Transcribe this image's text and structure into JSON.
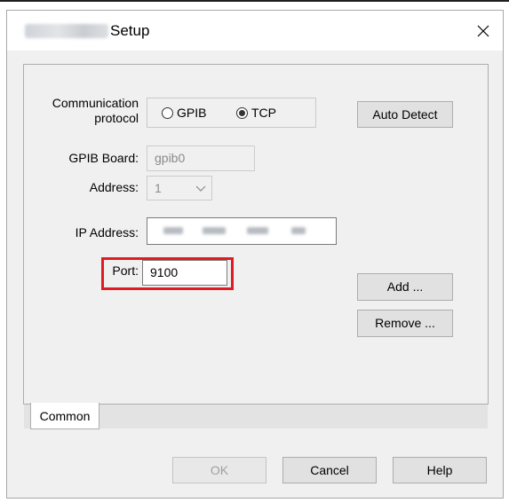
{
  "dialog": {
    "title": "Setup",
    "close_glyph": "✕",
    "icons": {
      "close": "close-icon",
      "dropdown": "chevron-down-icon"
    }
  },
  "protocol": {
    "label_line1": "Communication",
    "label_line2": "protocol",
    "options": [
      {
        "label": "GPIB",
        "checked": false
      },
      {
        "label": "TCP",
        "checked": true
      }
    ],
    "auto_detect_label": "Auto Detect"
  },
  "gpib": {
    "board_label": "GPIB Board:",
    "board_value": "gpib0",
    "address_label": "Address:",
    "address_value": "1"
  },
  "network": {
    "ip_label": "IP Address:",
    "port_label": "Port:",
    "port_value": "9100"
  },
  "actions": {
    "add_label": "Add ...",
    "remove_label": "Remove ..."
  },
  "tabs": [
    {
      "label": "Common",
      "active": true
    }
  ],
  "footer": {
    "ok_label": "OK",
    "cancel_label": "Cancel",
    "help_label": "Help"
  },
  "colors": {
    "highlight": "#e01b24"
  }
}
